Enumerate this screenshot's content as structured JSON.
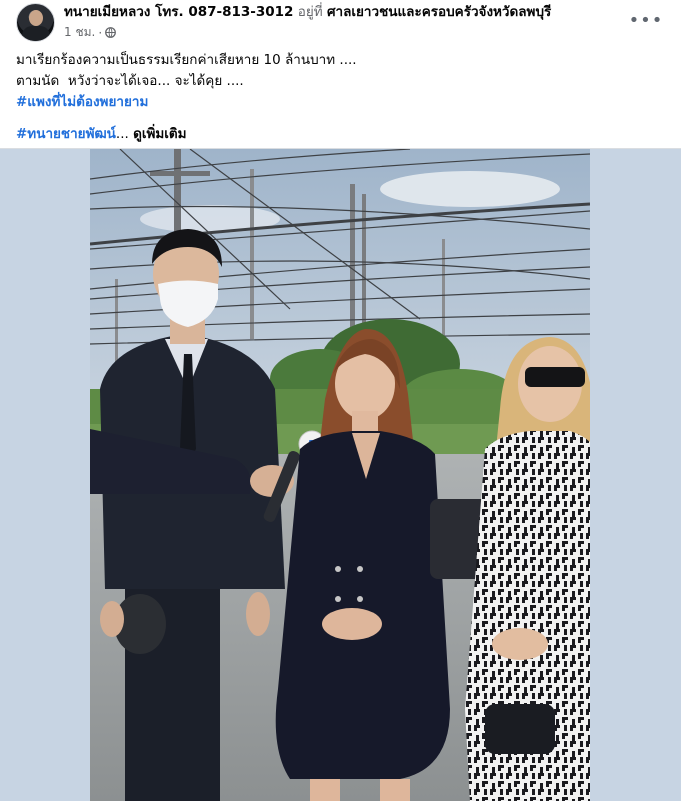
{
  "post": {
    "author": "ทนายเมียหลวง โทร. 087-813-3012",
    "at_word": "อยู่ที่",
    "place": "ศาลเยาวชนและครอบครัวจังหวัดลพบุรี",
    "time": "1 ชม.",
    "privacy_icon": "globe-icon",
    "more_icon": "more-horizontal-icon",
    "text_line_1": "มาเรียกร้องความเป็นธรรมเรียกค่าเสียหาย 10 ล้านบาท ....",
    "text_line_2": "ตามนัด  หวังว่าจะได้เจอ... จะได้คุย ....",
    "hashtag_1": "#แพงที่ไม่ต้องพยายาม",
    "hashtag_2": "#ทนายชายพัฒน์",
    "ellipsis": "...",
    "see_more": "ดูเพิ่มเติม"
  },
  "colors": {
    "hashtag": "#216fdb",
    "media_background": "#c7d4e3",
    "secondary_text": "#65676b"
  },
  "photo": {
    "microphone_logo": "3"
  }
}
